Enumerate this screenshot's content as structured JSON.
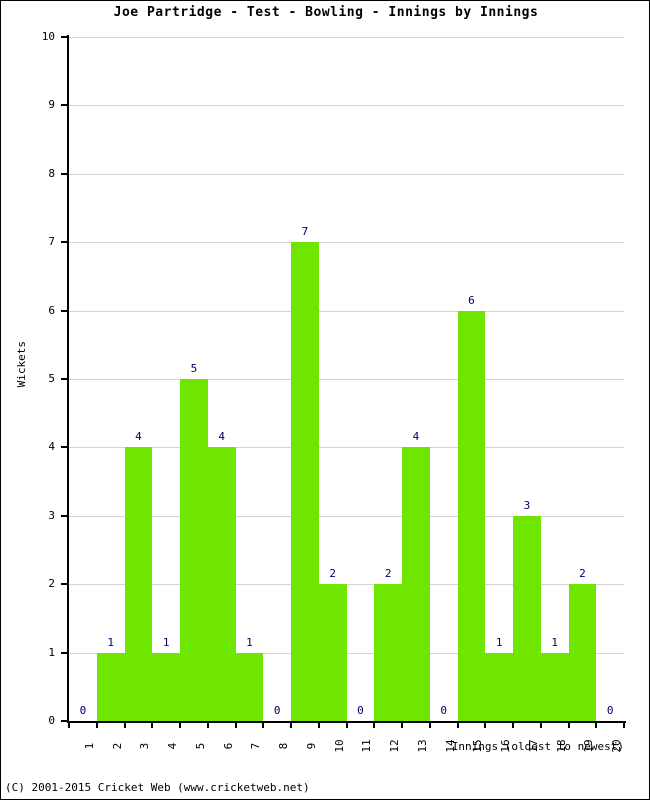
{
  "chart_data": {
    "type": "bar",
    "title": "Joe Partridge - Test - Bowling - Innings by Innings",
    "xlabel": "Innings (oldest to newest)",
    "ylabel": "Wickets",
    "categories": [
      "1",
      "2",
      "3",
      "4",
      "5",
      "6",
      "7",
      "8",
      "9",
      "10",
      "11",
      "12",
      "13",
      "14",
      "15",
      "16",
      "17",
      "18",
      "19",
      "20"
    ],
    "values": [
      0,
      1,
      4,
      1,
      5,
      4,
      1,
      0,
      7,
      2,
      0,
      2,
      4,
      0,
      6,
      1,
      3,
      1,
      2,
      0
    ],
    "ylim": [
      0,
      10
    ],
    "yticks": [
      0,
      1,
      2,
      3,
      4,
      5,
      6,
      7,
      8,
      9,
      10
    ],
    "ytick_labels": [
      "0",
      "1",
      "2",
      "3",
      "4",
      "5",
      "6",
      "7",
      "8",
      "9",
      "10"
    ],
    "grid": true,
    "legend": "none",
    "bar_color": "#6ee600",
    "label_color": "#000066",
    "grid_color": "#d4d4d4",
    "axis_color": "#000000",
    "bar_gap": 0,
    "data_labels_shown": true
  },
  "footer": {
    "copyright": "(C) 2001-2015 Cricket Web (www.cricketweb.net)"
  }
}
